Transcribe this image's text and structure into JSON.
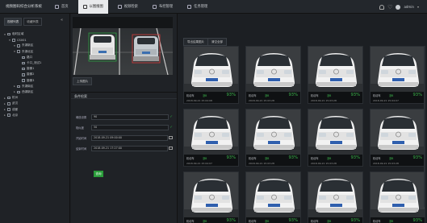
{
  "app": {
    "title": "视频图码综合分析系统"
  },
  "nav": [
    {
      "label": "首页",
      "icon": "home-icon"
    },
    {
      "label": "以图搜图",
      "icon": "image-search-icon",
      "active": true
    },
    {
      "label": "视频检索",
      "icon": "video-search-icon"
    },
    {
      "label": "布控管理",
      "icon": "surveillance-icon"
    },
    {
      "label": "任务管理",
      "icon": "task-icon"
    }
  ],
  "user": {
    "name": "admin"
  },
  "left": {
    "tabs": [
      "视频列表",
      "收藏列表"
    ],
    "tree": [
      {
        "label": "临时区域",
        "level": 0,
        "toggle": "▾"
      },
      {
        "label": "CS001",
        "level": 1,
        "toggle": "▾"
      },
      {
        "label": "东湖新区",
        "level": 2,
        "toggle": "▾"
      },
      {
        "label": "东湖北区",
        "level": 2,
        "toggle": "▾"
      },
      {
        "label": "路口",
        "level": 3,
        "toggle": ""
      },
      {
        "label": "卡口_测试1",
        "level": 3,
        "toggle": ""
      },
      {
        "label": "摄像1",
        "level": 3,
        "toggle": ""
      },
      {
        "label": "摄像2",
        "level": 3,
        "toggle": ""
      },
      {
        "label": "摄像3",
        "level": 3,
        "toggle": ""
      },
      {
        "label": "东湖南区",
        "level": 2,
        "toggle": "▸"
      },
      {
        "label": "西湖新区",
        "level": 2,
        "toggle": "▸"
      },
      {
        "label": "杭州",
        "level": 0,
        "toggle": "▸"
      },
      {
        "label": "武汉",
        "level": 0,
        "toggle": "▸"
      },
      {
        "label": "成都",
        "level": 0,
        "toggle": "▸"
      },
      {
        "label": "北京",
        "level": 0,
        "toggle": "▸"
      }
    ]
  },
  "center": {
    "play_label": "上传图片",
    "conditions_title": "条件检索",
    "form": [
      {
        "label": "阈值设置",
        "value": "90",
        "suffix": "check"
      },
      {
        "label": "相似度",
        "value": "50",
        "suffix": "check"
      },
      {
        "label": "开始时间",
        "value": "2018-09-21 09:00:00",
        "suffix": "calendar"
      },
      {
        "label": "结束时间",
        "value": "2018-09-21 17:27:00",
        "suffix": "calendar"
      }
    ],
    "query_label": "查询"
  },
  "results": {
    "buttons": [
      "导出结果图片",
      "清空全部"
    ],
    "cards": [
      {
        "caption": "机动车",
        "plate": "浙B",
        "score": "93%",
        "time": "2018-09-21 15:04:08"
      },
      {
        "caption": "机动车",
        "plate": "浙B",
        "score": "93%",
        "time": "2018-09-21 15:03:28"
      },
      {
        "caption": "机动车",
        "plate": "浙B",
        "score": "93%",
        "time": "2018-09-21 15:03:28"
      },
      {
        "caption": "机动车",
        "plate": "浙B",
        "score": "93%",
        "time": "2018-09-21 15:04:07"
      },
      {
        "caption": "机动车",
        "plate": "浙B",
        "score": "93%",
        "time": "2018-09-21 15:04:07"
      },
      {
        "caption": "机动车",
        "plate": "浙B",
        "score": "93%",
        "time": "2018-09-21 15:03:28"
      },
      {
        "caption": "机动车",
        "plate": "浙B",
        "score": "93%",
        "time": "2018-09-21 15:03:28"
      },
      {
        "caption": "机动车",
        "plate": "浙B",
        "score": "93%",
        "time": "2018-09-21 15:03:28"
      },
      {
        "caption": "机动车",
        "plate": "浙B",
        "score": "93%",
        "time": "2018-09-21 15:04:07"
      },
      {
        "caption": "机动车",
        "plate": "浙B",
        "score": "93%",
        "time": "2018-09-21 15:03:28"
      },
      {
        "caption": "机动车",
        "plate": "浙B",
        "score": "93%",
        "time": "2018-09-21 15:03:28"
      },
      {
        "caption": "机动车",
        "plate": "浙B",
        "score": "93%",
        "time": "2018-09-21 15:03:28"
      }
    ]
  },
  "colors": {
    "accent_green": "#2a9d3a",
    "score_green": "#3cb44b",
    "active_tab_bg": "#e8eaec"
  }
}
